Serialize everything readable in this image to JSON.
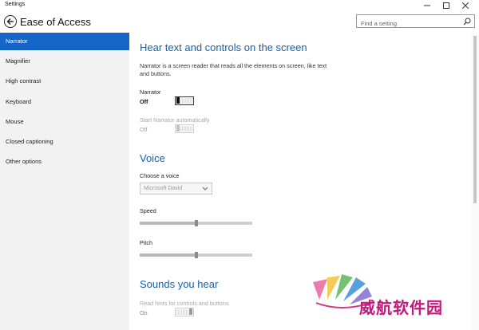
{
  "window": {
    "title": "Settings"
  },
  "header": {
    "page_title": "Ease of Access",
    "search_placeholder": "Find a setting"
  },
  "sidebar": {
    "items": [
      {
        "label": "Narrator",
        "active": true
      },
      {
        "label": "Magnifier",
        "active": false
      },
      {
        "label": "High contrast",
        "active": false
      },
      {
        "label": "Keyboard",
        "active": false
      },
      {
        "label": "Mouse",
        "active": false
      },
      {
        "label": "Closed captioning",
        "active": false
      },
      {
        "label": "Other options",
        "active": false
      }
    ]
  },
  "main": {
    "hear": {
      "title": "Hear text and controls on the screen",
      "description": "Narrator is a screen reader that reads all the elements on screen, like text and buttons.",
      "narrator_label": "Narrator",
      "narrator_state": "Off",
      "auto_label": "Start Narrator automatically",
      "auto_state": "Off"
    },
    "voice": {
      "title": "Voice",
      "choose_label": "Choose a voice",
      "choose_value": "Microsoft David",
      "speed_label": "Speed",
      "speed_value": 0.5,
      "pitch_label": "Pitch",
      "pitch_value": 0.5
    },
    "sounds": {
      "title": "Sounds you hear",
      "hints_label": "Read hints for controls and buttons",
      "hints_state": "On"
    }
  },
  "watermark": {
    "text": "威航软件园"
  },
  "colors": {
    "accent": "#1565c8",
    "section_title": "#1b5fa8",
    "sidebar_bg": "#f2f2f2"
  }
}
